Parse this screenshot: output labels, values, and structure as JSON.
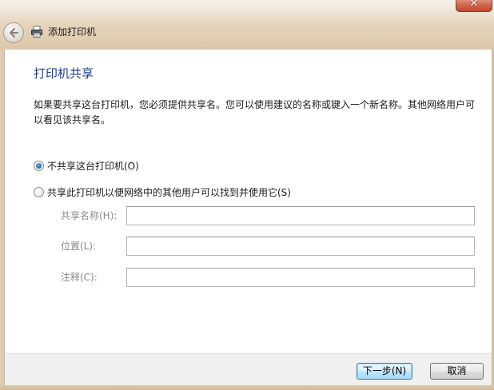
{
  "window": {
    "title": "添加打印机",
    "close_glyph": "✕"
  },
  "page": {
    "heading": "打印机共享",
    "description": "如果要共享这台打印机，您必须提供共享名。您可以使用建议的名称或键入一个新名称。其他网络用户可以看见该共享名。"
  },
  "options": {
    "no_share": {
      "label": "不共享这台打印机(O)",
      "selected": true
    },
    "share": {
      "label": "共享此打印机以便网络中的其他用户可以找到并使用它(S)",
      "selected": false
    }
  },
  "fields": {
    "share_name": {
      "label": "共享名称(H):",
      "value": ""
    },
    "location": {
      "label": "位置(L):",
      "value": ""
    },
    "comment": {
      "label": "注释(C):",
      "value": ""
    }
  },
  "buttons": {
    "next": "下一步(N)",
    "cancel": "取消"
  },
  "icons": {
    "back": "back-arrow-icon",
    "printer": "printer-icon",
    "close": "close-icon"
  }
}
